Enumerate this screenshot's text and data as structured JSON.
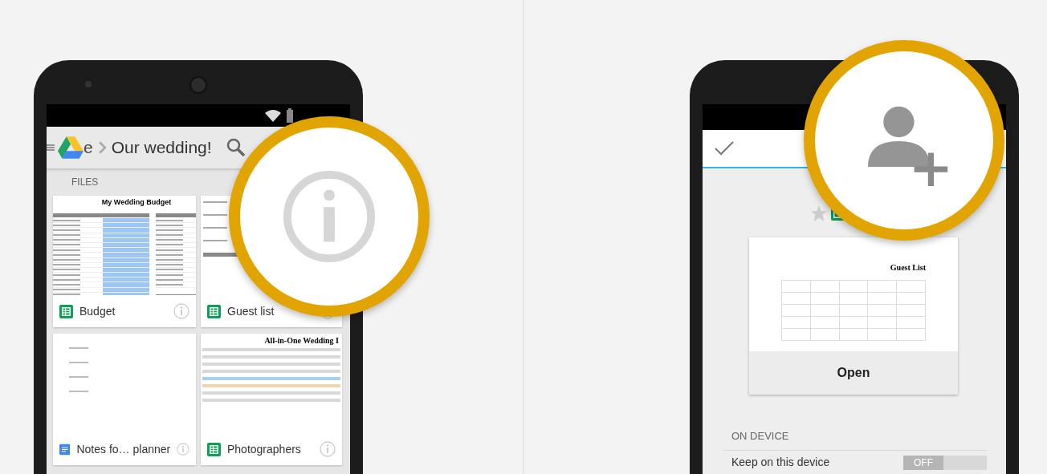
{
  "drive_screen": {
    "app_bar": {
      "breadcrumb_parent": "e",
      "title": "Our wedding!"
    },
    "section_label": "FILES",
    "files": [
      {
        "name": "Budget",
        "kind": "sheet",
        "thumbnail": {
          "kind": "budget",
          "title": "My Wedding Budget"
        }
      },
      {
        "name": "Guest list",
        "kind": "sheet",
        "thumbnail": {
          "kind": "guests"
        }
      },
      {
        "name": "Notes fo… planner",
        "kind": "doc",
        "thumbnail": {
          "kind": "notes"
        }
      },
      {
        "name": "Photographers",
        "kind": "sheet",
        "thumbnail": {
          "kind": "planner",
          "title": "All-in-One Wedding I"
        }
      }
    ]
  },
  "details_screen": {
    "preview": {
      "title": "Guest List",
      "action": "Open"
    },
    "section_label": "ON DEVICE",
    "setting": {
      "label": "Keep on this device",
      "state_text": "OFF",
      "on": false
    }
  }
}
